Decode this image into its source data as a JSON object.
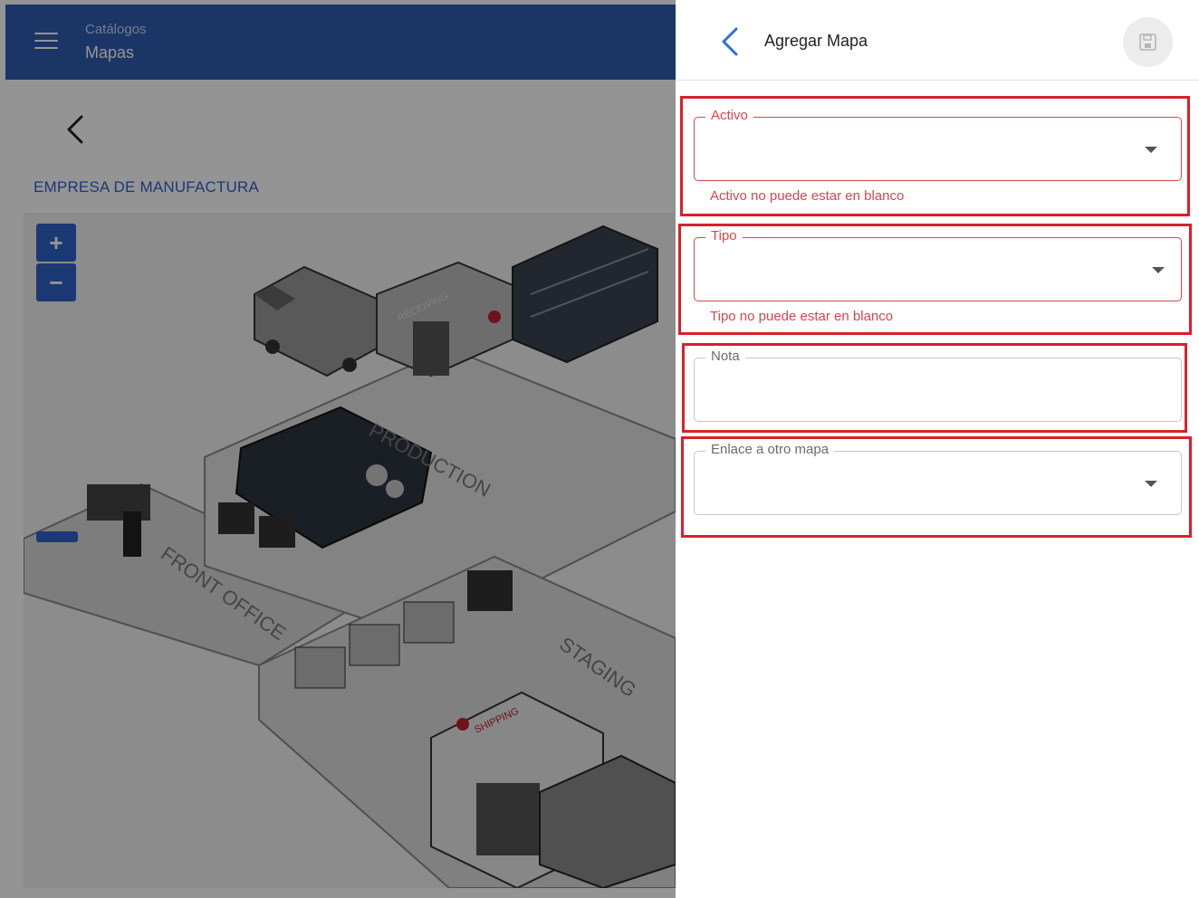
{
  "app": {
    "breadcrumb_parent": "Catálogos",
    "breadcrumb_current": "Mapas",
    "company": "EMPRESA DE MANUFACTURA",
    "zoom_in": "+",
    "zoom_out": "−",
    "map_labels": [
      "PRODUCTION",
      "FRONT OFFICE",
      "STAGING",
      "RECEIVING",
      "SHIPPING"
    ],
    "accent": "#2f63c9",
    "appbar_color": "#2f5db0"
  },
  "panel": {
    "title": "Agregar Mapa",
    "back_icon": "chevron-left-icon",
    "save_icon": "floppy-disk-icon",
    "fields": {
      "activo": {
        "label": "Activo",
        "value": "",
        "error": "Activo no puede estar en blanco"
      },
      "tipo": {
        "label": "Tipo",
        "value": "",
        "error": "Tipo no puede estar en blanco"
      },
      "nota": {
        "label": "Nota",
        "value": ""
      },
      "enlace": {
        "label": "Enlace a otro mapa",
        "value": ""
      }
    },
    "error_color": "#d9444d",
    "highlight_color": "#d8202c"
  }
}
